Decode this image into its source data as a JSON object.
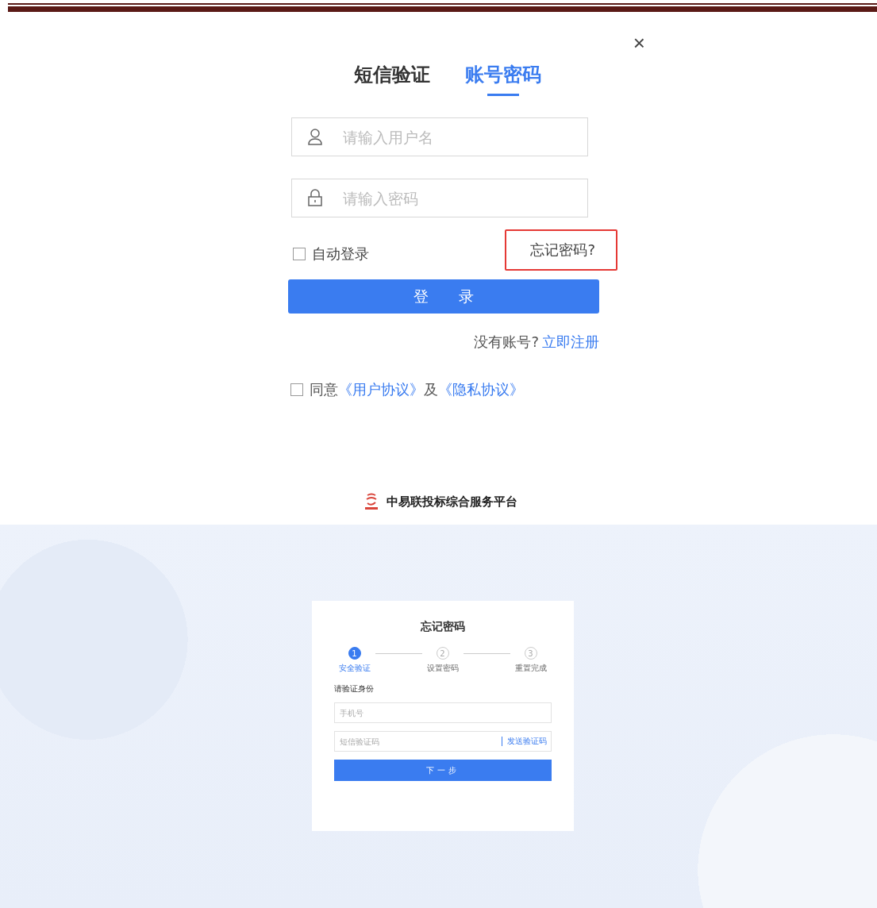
{
  "login": {
    "close": "×",
    "tabs": [
      {
        "label": "短信验证",
        "selected": false
      },
      {
        "label": "账号密码",
        "selected": true
      }
    ],
    "fields": [
      {
        "kind": "user",
        "placeholder": "请输入用户名"
      },
      {
        "kind": "lock",
        "placeholder": "请输入密码"
      }
    ],
    "auto_login": {
      "label": "自动登录",
      "checked": false
    },
    "forgot": {
      "label": "忘记密码?",
      "highlighted": true
    },
    "submit": "登　　录",
    "register": {
      "prompt": "没有账号?",
      "link": "立即注册"
    },
    "agreement": {
      "checked": false,
      "parts": [
        {
          "kind": "plain",
          "text": "同意"
        },
        {
          "kind": "link",
          "text": "《用户协议》"
        },
        {
          "kind": "plain",
          "text": "及"
        },
        {
          "kind": "link",
          "text": "《隐私协议》"
        }
      ]
    }
  },
  "brand": {
    "title": "中易联投标综合服务平台"
  },
  "reset": {
    "title": "忘记密码",
    "steps": [
      {
        "number": "1",
        "label": "安全验证",
        "selected": true
      },
      {
        "number": "2",
        "label": "设置密码",
        "selected": false
      },
      {
        "number": "3",
        "label": "重置完成",
        "selected": false
      }
    ],
    "prompt": "请验证身份",
    "fields": [
      {
        "placeholder": "手机号"
      },
      {
        "placeholder": "短信验证码",
        "action": "发送验证码"
      }
    ],
    "submit": "下一步"
  }
}
